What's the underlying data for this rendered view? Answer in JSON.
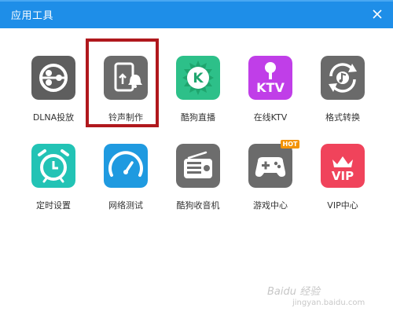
{
  "window": {
    "title": "应用工具"
  },
  "tools": [
    {
      "id": "dlna",
      "label": "DLNA投放",
      "icon": "dlna-cast-icon",
      "color": "#5e5e5e"
    },
    {
      "id": "ringtone",
      "label": "铃声制作",
      "icon": "ringtone-maker-icon",
      "color": "#6b6b6b"
    },
    {
      "id": "live",
      "label": "酷狗直播",
      "icon": "kugou-live-icon",
      "color": "#2dc089"
    },
    {
      "id": "ktv",
      "label": "在线KTV",
      "icon": "ktv-icon",
      "color": "#c03ee8"
    },
    {
      "id": "format",
      "label": "格式转换",
      "icon": "format-convert-icon",
      "color": "#6a6a6a"
    },
    {
      "id": "timer",
      "label": "定时设置",
      "icon": "alarm-clock-icon",
      "color": "#22c3b5"
    },
    {
      "id": "speed",
      "label": "网络测试",
      "icon": "speedometer-icon",
      "color": "#1f9ae0"
    },
    {
      "id": "radio",
      "label": "酷狗收音机",
      "icon": "radio-icon",
      "color": "#6d6d6d"
    },
    {
      "id": "games",
      "label": "游戏中心",
      "icon": "gamepad-icon",
      "color": "#6b6b6b",
      "badge": "HOT"
    },
    {
      "id": "vip",
      "label": "VIP中心",
      "icon": "vip-crown-icon",
      "color": "#f0435b"
    }
  ],
  "watermark": {
    "line1": "Baidu 经验",
    "line2": "jingyan.baidu.com"
  }
}
